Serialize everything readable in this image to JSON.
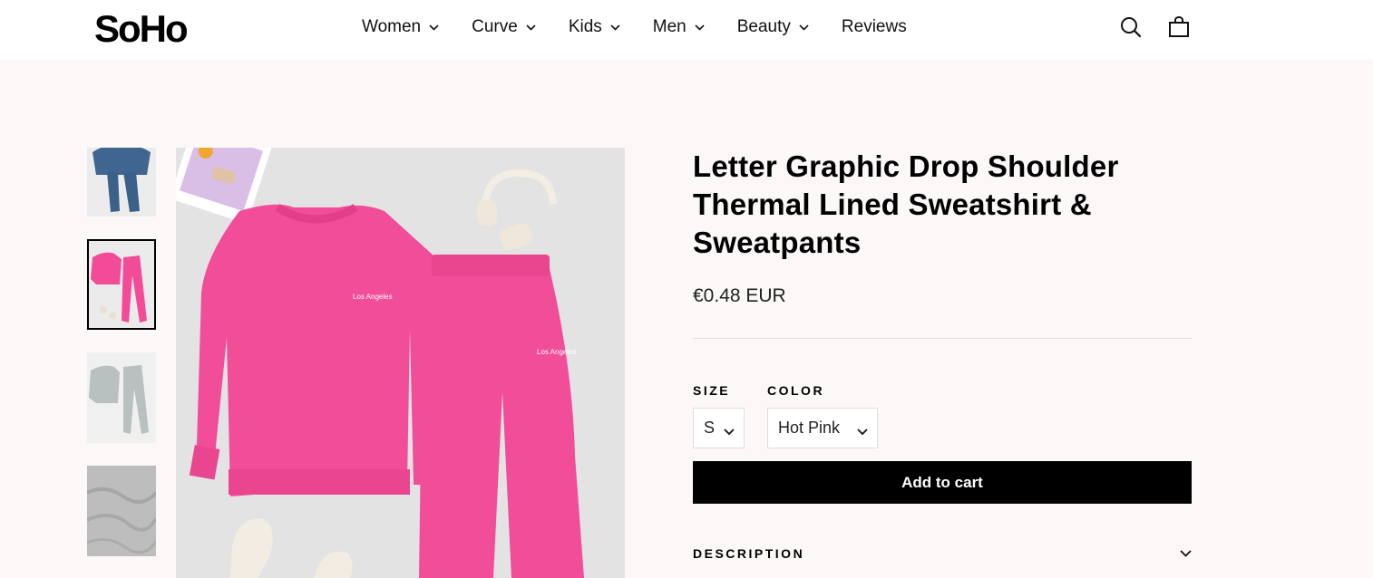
{
  "brand": {
    "logo_text": "SoHo"
  },
  "nav": {
    "items": [
      {
        "label": "Women",
        "has_dropdown": true
      },
      {
        "label": "Curve",
        "has_dropdown": true
      },
      {
        "label": "Kids",
        "has_dropdown": true
      },
      {
        "label": "Men",
        "has_dropdown": true
      },
      {
        "label": "Beauty",
        "has_dropdown": true
      },
      {
        "label": "Reviews",
        "has_dropdown": false
      }
    ]
  },
  "header_icons": [
    "search-icon",
    "cart-icon"
  ],
  "gallery": {
    "thumbnails": [
      {
        "name": "blue-set",
        "color": "#3e6690"
      },
      {
        "name": "hot-pink-set",
        "color": "#f24b97",
        "active": true
      },
      {
        "name": "grey-set",
        "color": "#b9c1c1"
      },
      {
        "name": "grey-fabric",
        "color": "#bdbdbd"
      }
    ],
    "main_image": {
      "sweatshirt_print": "Los Angeles",
      "pants_print": "Los Angeles",
      "garment_color": "#f24d98"
    }
  },
  "product": {
    "title": "Letter Graphic Drop Shoulder Thermal Lined Sweatshirt & Sweatpants",
    "price": "€0.48 EUR",
    "size_label": "SIZE",
    "size_value": "S",
    "color_label": "COLOR",
    "color_value": "Hot Pink",
    "add_to_cart": "Add to cart",
    "description_label": "DESCRIPTION"
  },
  "colors": {
    "accent": "#000000",
    "page_bg": "#fcf8f8",
    "header_bg": "#ffffff"
  }
}
